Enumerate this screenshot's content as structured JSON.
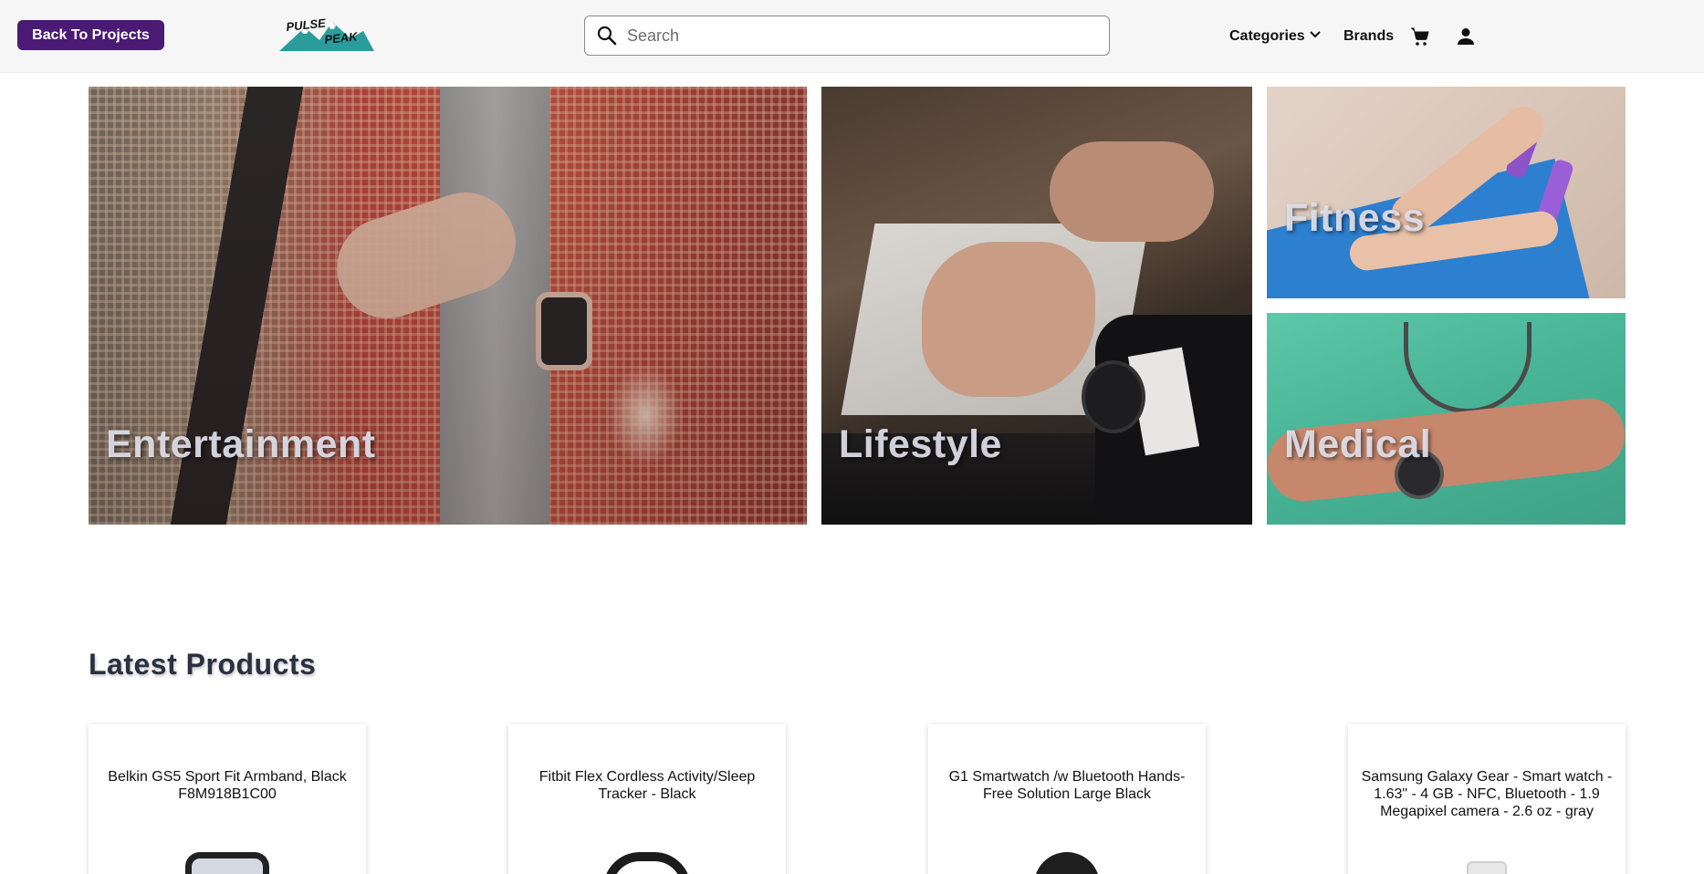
{
  "header": {
    "back_label": "Back To Projects",
    "logo_text_1": "PULSE",
    "logo_text_2": "PEAK",
    "search_placeholder": "Search",
    "search_value": "",
    "nav_categories": "Categories",
    "nav_brands": "Brands",
    "icons": [
      "search-icon",
      "chevron-down-icon",
      "cart-icon",
      "user-icon"
    ]
  },
  "hero": {
    "tiles": [
      {
        "label": "Entertainment"
      },
      {
        "label": "Lifestyle"
      },
      {
        "label": "Fitness"
      },
      {
        "label": "Medical"
      }
    ]
  },
  "latest": {
    "title": "Latest Products",
    "products": [
      {
        "name": "Belkin GS5 Sport Fit Armband, Black F8M918B1C00"
      },
      {
        "name": "Fitbit Flex Cordless Activity/Sleep Tracker - Black"
      },
      {
        "name": "G1 Smartwatch /w Bluetooth Hands-Free Solution Large Black"
      },
      {
        "name": "Samsung Galaxy Gear - Smart watch - 1.63\" - 4 GB - NFC, Bluetooth - 1.9 Megapixel camera - 2.6 oz - gray"
      }
    ]
  },
  "colors": {
    "brand": "#4a1a74",
    "header_bg": "#f6f6f6",
    "title": "#2a3140",
    "logo_teal": "#2b9c9c"
  }
}
